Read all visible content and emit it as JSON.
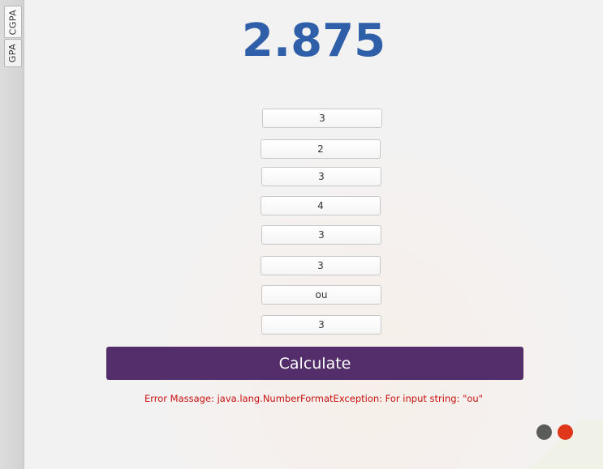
{
  "sidebar": {
    "tabs": [
      {
        "label": "CGPA"
      },
      {
        "label": "GPA"
      }
    ]
  },
  "result": {
    "value": "2.875"
  },
  "inputs": [
    {
      "value": "3"
    },
    {
      "value": "2"
    },
    {
      "value": "3"
    },
    {
      "value": "4"
    },
    {
      "value": "3"
    },
    {
      "value": "3"
    },
    {
      "value": "ou"
    },
    {
      "value": "3"
    }
  ],
  "calculate": {
    "label": "Calculate"
  },
  "error": {
    "text": "Error Massage: java.lang.NumberFormatException: For input string: \"ou\""
  },
  "colors": {
    "result": "#2e5fa8",
    "button": "#542d6b",
    "error": "#c81010",
    "dot_gray": "#5a5c5a",
    "dot_red": "#e0361a"
  },
  "indicators": [
    {
      "icon": "gray-dot-icon"
    },
    {
      "icon": "red-dot-icon"
    }
  ]
}
